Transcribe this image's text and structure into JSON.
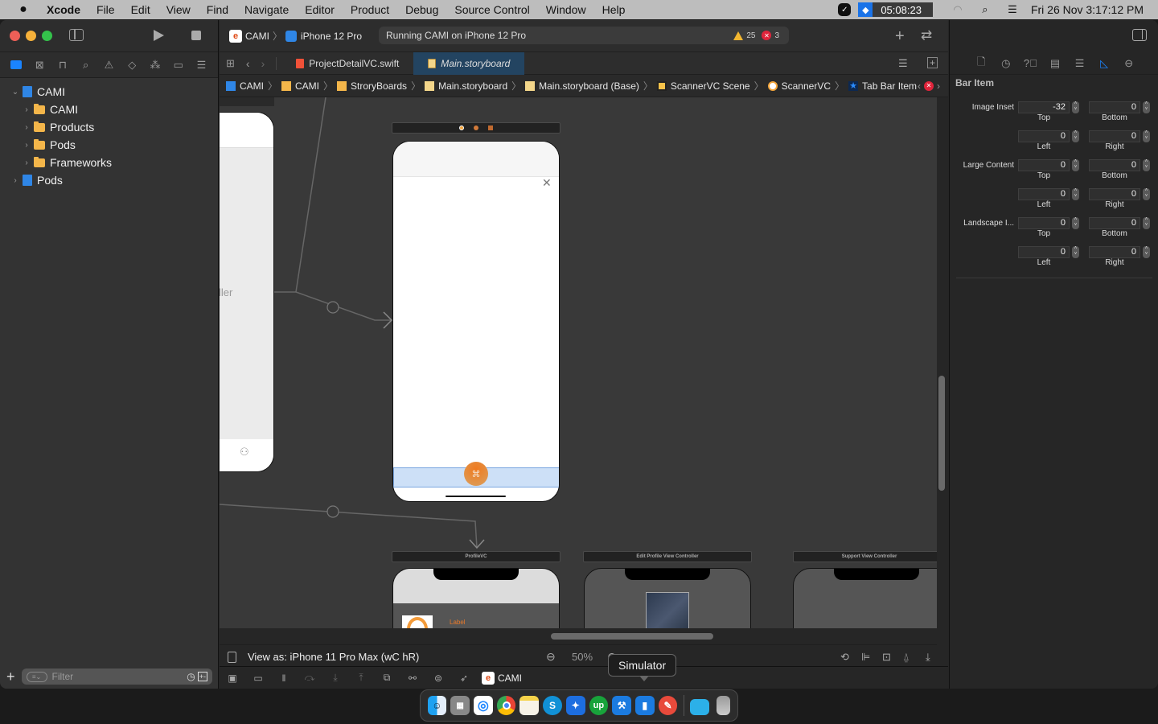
{
  "menubar": {
    "app": "Xcode",
    "items": [
      "File",
      "Edit",
      "View",
      "Find",
      "Navigate",
      "Editor",
      "Product",
      "Debug",
      "Source Control",
      "Window",
      "Help"
    ],
    "timer": "05:08:23",
    "datetime": "Fri 26 Nov  3:17:12 PM"
  },
  "toolbar": {
    "scheme": "CAMI",
    "device": "iPhone 12 Pro",
    "status": "Running CAMI on iPhone 12 Pro",
    "warnings": "25",
    "errors": "3"
  },
  "navigator": {
    "tree": [
      {
        "label": "CAMI",
        "type": "project",
        "expanded": true,
        "level": 0
      },
      {
        "label": "CAMI",
        "type": "folder",
        "level": 1
      },
      {
        "label": "Products",
        "type": "folder",
        "level": 1
      },
      {
        "label": "Pods",
        "type": "folder",
        "level": 1
      },
      {
        "label": "Frameworks",
        "type": "folder",
        "level": 1
      },
      {
        "label": "Pods",
        "type": "project",
        "expanded": false,
        "level": 0
      }
    ],
    "filter_placeholder": "Filter"
  },
  "editor": {
    "tabs": [
      {
        "label": "ProjectDetailVC.swift",
        "active": false
      },
      {
        "label": "Main.storyboard",
        "active": true
      }
    ],
    "breadcrumbs": [
      "CAMI",
      "CAMI",
      "StroryBoards",
      "Main.storyboard",
      "Main.storyboard (Base)",
      "ScannerVC Scene",
      "ScannerVC",
      "Tab Bar Item"
    ],
    "canvas": {
      "partial_label": "ller",
      "scenes": [
        "ProfileVC",
        "Edit Profile View Controller",
        "Support View Controller"
      ],
      "profile_label": "Label"
    },
    "view_as": "View as: iPhone 11 Pro Max (wC hR)",
    "zoom": "50%",
    "debug_target": "CAMI",
    "tooltip": "Simulator"
  },
  "inspector": {
    "title": "Bar Item",
    "groups": [
      {
        "label": "Image Inset",
        "rows": [
          [
            {
              "value": "-32",
              "sub": "Top"
            },
            {
              "value": "0",
              "sub": "Bottom"
            }
          ],
          [
            {
              "value": "0",
              "sub": "Left"
            },
            {
              "value": "0",
              "sub": "Right"
            }
          ]
        ]
      },
      {
        "label": "Large Content",
        "rows": [
          [
            {
              "value": "0",
              "sub": "Top"
            },
            {
              "value": "0",
              "sub": "Bottom"
            }
          ],
          [
            {
              "value": "0",
              "sub": "Left"
            },
            {
              "value": "0",
              "sub": "Right"
            }
          ]
        ]
      },
      {
        "label": "Landscape I...",
        "rows": [
          [
            {
              "value": "0",
              "sub": "Top"
            },
            {
              "value": "0",
              "sub": "Bottom"
            }
          ],
          [
            {
              "value": "0",
              "sub": "Left"
            },
            {
              "value": "0",
              "sub": "Right"
            }
          ]
        ]
      }
    ]
  },
  "dock": [
    "Finder",
    "Launchpad",
    "Safari",
    "Chrome",
    "Notes",
    "Skype",
    "Clockify",
    "Upwork",
    "Xcode",
    "Simulator",
    "Instruments",
    "Folder",
    "Trash"
  ]
}
